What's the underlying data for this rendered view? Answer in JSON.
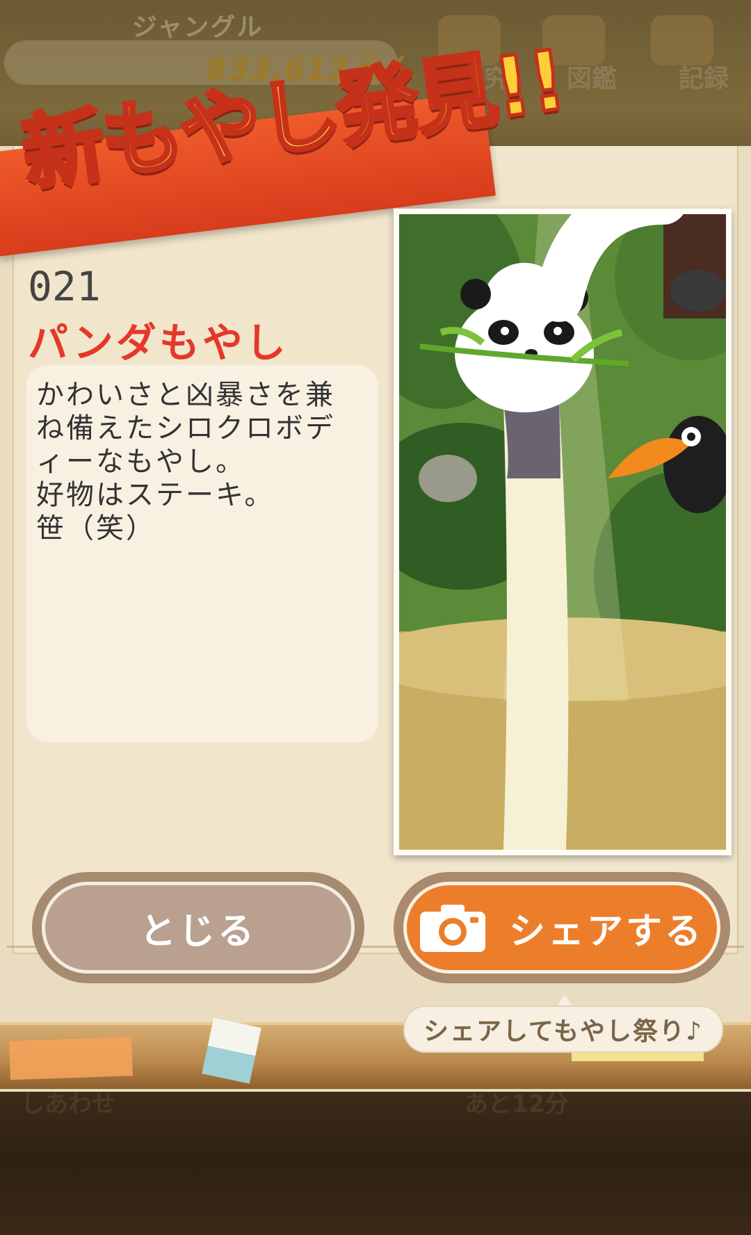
{
  "header": {
    "stage_name": "ジャングル",
    "money": "833,613えん",
    "nav": [
      {
        "label": "研究",
        "icon": "flask-icon"
      },
      {
        "label": "図鑑",
        "icon": "book-icon"
      },
      {
        "label": "記録",
        "icon": "trophy-icon"
      }
    ]
  },
  "banner": {
    "text": "新もやし発見!!"
  },
  "item": {
    "number": "021",
    "name": "パンダもやし",
    "description_lines": [
      "かわいさと凶暴さを兼",
      "ね備えたシロクロボデ",
      "ィーなもやし。",
      "好物はステーキ。",
      "笹（笑）"
    ]
  },
  "buttons": {
    "close_label": "とじる",
    "share_label": "シェアする",
    "share_tip": "シェアしてもやし祭り♪"
  },
  "bottom": {
    "left_label": "しあわせ",
    "center_label": "あと12分"
  },
  "colors": {
    "banner": "#e04a22",
    "banner_text": "#fdd03a",
    "item_name": "#e5382a",
    "share_button": "#ec7e2b",
    "close_button": "#b9a08f"
  }
}
